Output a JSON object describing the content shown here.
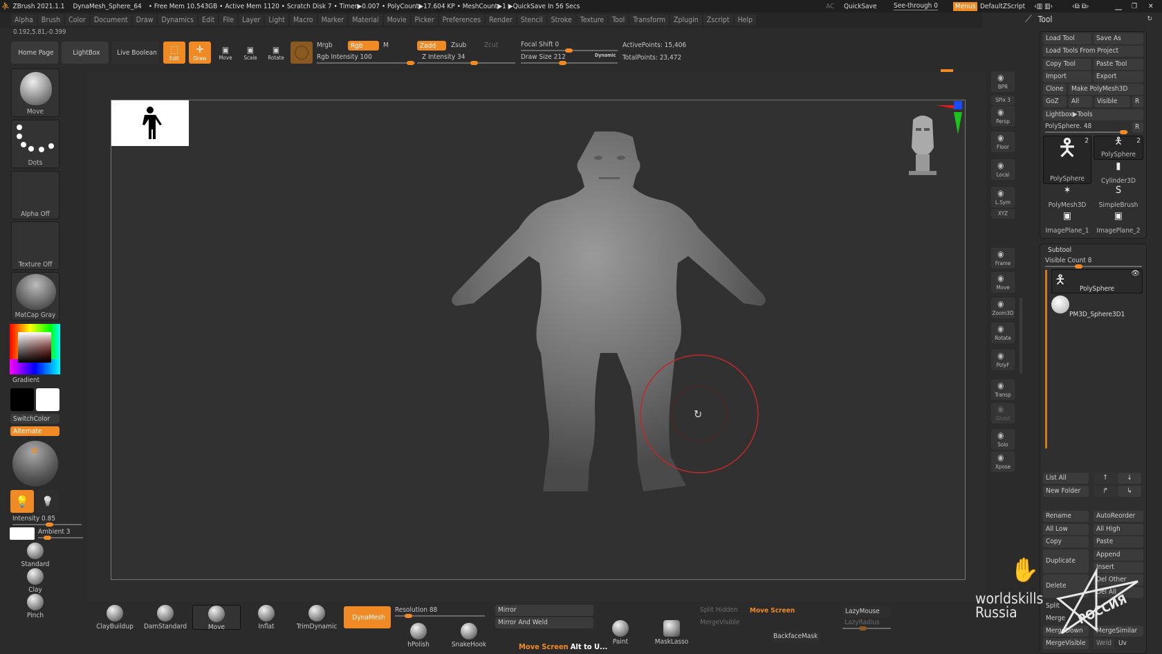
{
  "titlebar": {
    "app": "ZBrush 2021.1.1",
    "doc": "DynaMesh_Sphere_64",
    "status": "• Free Mem 10.543GB • Active Mem 1120 • Scratch Disk 7 • Timer▶0.007 • PolyCount▶17.604 KP • MeshCount▶1 ▶QuickSave In 56 Secs",
    "ac": "AC",
    "quicksave": "QuickSave",
    "seethrough": "See-through  0",
    "menus": "Menus",
    "script": "DefaultZScript"
  },
  "menus": [
    "Alpha",
    "Brush",
    "Color",
    "Document",
    "Draw",
    "Dynamics",
    "Edit",
    "File",
    "Layer",
    "Light",
    "Macro",
    "Marker",
    "Material",
    "Movie",
    "Picker",
    "Preferences",
    "Render",
    "Stencil",
    "Stroke",
    "Texture",
    "Tool",
    "Transform",
    "Zplugin",
    "Zscript",
    "Help"
  ],
  "coords": "0.192,5.81,-0.399",
  "toolbar": {
    "home": "Home Page",
    "lightbox": "LightBox",
    "liveboolean": "Live Boolean",
    "edit": "Edit",
    "draw": "Draw",
    "move": "Move",
    "scale": "Scale",
    "rotate": "Rotate",
    "mrgb": "Mrgb",
    "rgb": "Rgb",
    "m": "M",
    "rgb_intensity": "Rgb Intensity 100",
    "zadd": "Zadd",
    "zsub": "Zsub",
    "zcut": "Zcut",
    "z_intensity": "Z Intensity 34",
    "focal_shift": "Focal Shift 0",
    "draw_size": "Draw Size 212",
    "dynamic": "Dynamic",
    "active_points": "ActivePoints: 15,406",
    "total_points": "TotalPoints: 23,472"
  },
  "left_shelf": {
    "brush": "Move",
    "stroke": "Dots",
    "alpha": "Alpha Off",
    "texture": "Texture Off",
    "material": "MatCap Gray",
    "gradient": "Gradient",
    "switchcolor": "SwitchColor",
    "alternate": "Alternate",
    "intensity": "Intensity 0.85",
    "ambient": "Ambient 3",
    "brushes": [
      "Standard",
      "Clay",
      "Pinch"
    ]
  },
  "right_shelf": [
    "BPR",
    "SPix 3",
    "Persp",
    "Floor",
    "Local",
    "L.Sym",
    "XYZ",
    "Frame",
    "Move",
    "Zoom3D",
    "Rotate",
    "PolyF",
    "Transp",
    "Ghost",
    "Solo",
    "Xpose"
  ],
  "tool_panel": {
    "title": "Tool",
    "load_tool": "Load Tool",
    "save_as": "Save As",
    "load_from_project": "Load Tools From Project",
    "copy_tool": "Copy Tool",
    "paste_tool": "Paste Tool",
    "import": "Import",
    "export": "Export",
    "clone": "Clone",
    "make_polymesh": "Make PolyMesh3D",
    "goz": "GoZ",
    "all": "All",
    "visible": "Visible",
    "r": "R",
    "lightbox_tools": "Lightbox▶Tools",
    "current_tool": "PolySphere. 48",
    "tools": [
      {
        "name": "PolySphere",
        "count": "2"
      },
      {
        "name": "PolySphere",
        "count": "2"
      },
      {
        "name": "Cylinder3D"
      },
      {
        "name": "PolyMesh3D"
      },
      {
        "name": "SimpleBrush"
      },
      {
        "name": "ImagePlane_1"
      },
      {
        "name": "ImagePlane_2"
      }
    ]
  },
  "subtool": {
    "title": "Subtool",
    "visible_count": "Visible Count 8",
    "items": [
      "PolySphere",
      "PM3D_Sphere3D1"
    ],
    "buttons": {
      "list_all": "List All",
      "new_folder": "New Folder",
      "rename": "Rename",
      "autoreorder": "AutoReorder",
      "all_low": "All Low",
      "all_high": "All High",
      "copy": "Copy",
      "paste": "Paste",
      "duplicate": "Duplicate",
      "append": "Append",
      "insert": "Insert",
      "delete": "Delete",
      "del_other": "Del Other",
      "del_all": "Del All",
      "split": "Split",
      "merge": "Merge",
      "mergedown": "MergeDown",
      "mergesimilar": "MergeSimilar",
      "mergevisible": "MergeVisible",
      "weld": "Weld",
      "uv": "Uv"
    }
  },
  "bottom_shelf": {
    "brushes": [
      "ClayBuildup",
      "DamStandard",
      "Move",
      "Inflat",
      "TrimDynamic"
    ],
    "dynamesh": "DynaMesh",
    "resolution": "Resolution 88",
    "hpolish": "hPolish",
    "snakehook": "SnakeHook",
    "mirror": "Mirror",
    "mirror_weld": "Mirror And Weld",
    "paint": "Paint",
    "masklasso": "MaskLasso",
    "split_hidden": "Split Hidden",
    "mergevisible": "MergeVisible",
    "backfacemask": "BackfaceMask",
    "lazymouse": "LazyMouse",
    "lazyradius": "LazyRadius",
    "hint_orange": "Move Screen",
    "hint_white": "Alt to U..."
  },
  "watermark": {
    "line1": "worldskills",
    "line2": "Russia",
    "seal": "РОССИЯ национальная сборная"
  },
  "values": {
    "rgb_intensity": 100,
    "z_intensity": 34,
    "focal_shift": 0,
    "draw_size": 212,
    "spix": 3,
    "resolution": 88,
    "intensity": 0.85,
    "ambient": 3,
    "visible_count": 8
  },
  "colors": {
    "accent": "#f08a24",
    "bg": "#2b2b2b",
    "canvas": "#2f2f2f",
    "brush_circle": "#c0282a"
  }
}
